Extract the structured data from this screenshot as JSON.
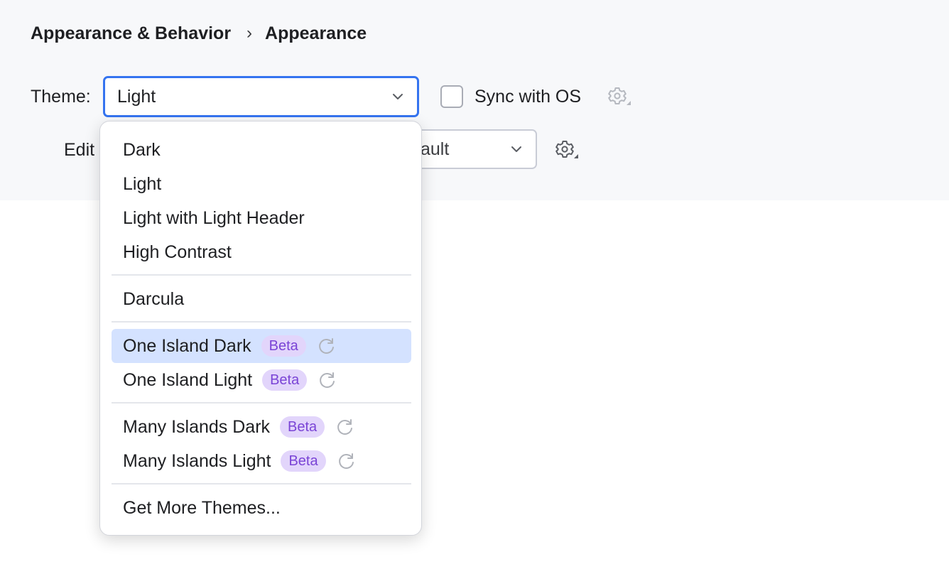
{
  "breadcrumb": {
    "parent": "Appearance & Behavior",
    "separator": "›",
    "current": "Appearance"
  },
  "theme": {
    "label": "Theme:",
    "selected": "Light"
  },
  "sync": {
    "label": "Sync with OS",
    "checked": false
  },
  "editor": {
    "label_visible": "Edit",
    "value_visible": "ault"
  },
  "dropdown": {
    "items": [
      {
        "label": "Dark"
      },
      {
        "label": "Light"
      },
      {
        "label": "Light with Light Header"
      },
      {
        "label": "High Contrast"
      },
      {
        "label": "Darcula"
      },
      {
        "label": "One Island Dark",
        "badge": "Beta",
        "icon": "reload-icon",
        "highlighted": true
      },
      {
        "label": "One Island Light",
        "badge": "Beta",
        "icon": "reload-icon"
      },
      {
        "label": "Many Islands Dark",
        "badge": "Beta",
        "icon": "reload-icon"
      },
      {
        "label": "Many Islands Light",
        "badge": "Beta",
        "icon": "reload-icon"
      },
      {
        "label": "Get More Themes..."
      }
    ]
  },
  "colors": {
    "accent": "#3574f0",
    "highlight": "#d4e2ff",
    "badge_bg": "#e2d5fb",
    "badge_text": "#7a44d6",
    "header_bg": "#f7f8fa"
  }
}
